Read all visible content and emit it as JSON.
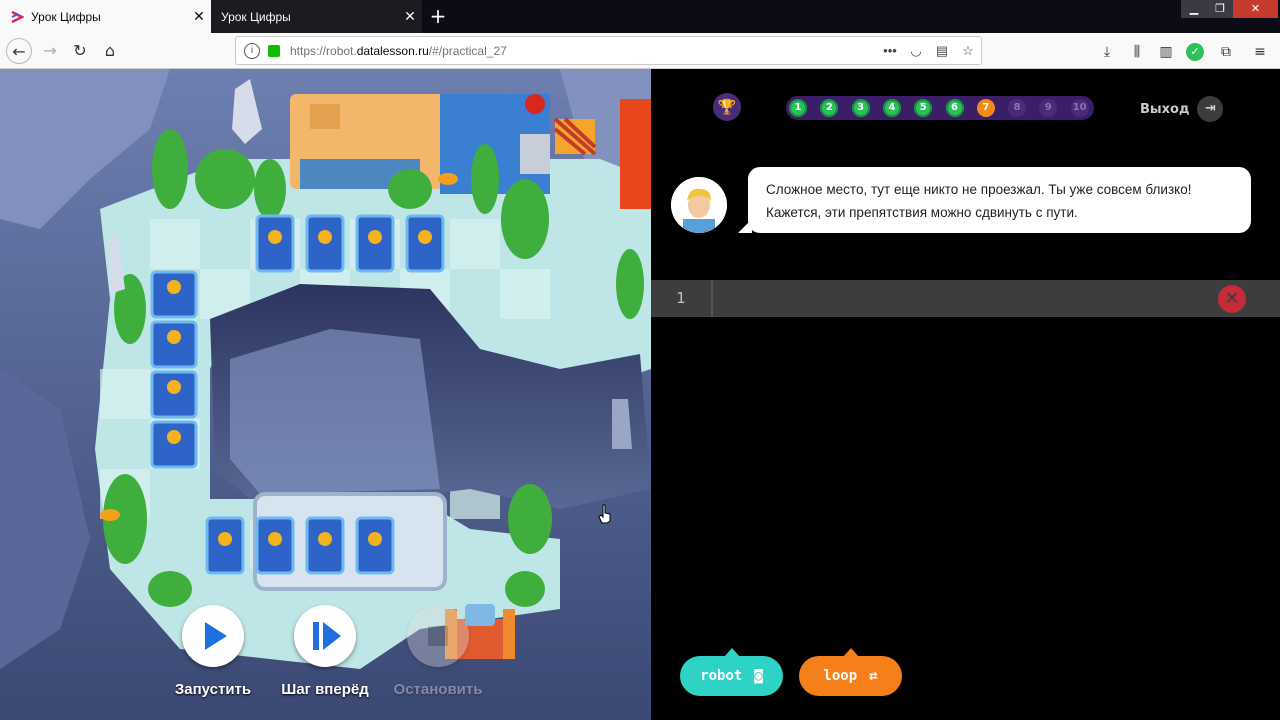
{
  "browser": {
    "tabs": [
      {
        "title": "Урок Цифры",
        "active": true
      },
      {
        "title": "Урок Цифры",
        "active": false
      }
    ],
    "url_prefix": "https://robot.",
    "url_domain": "datalesson.ru",
    "url_suffix": "/#/practical_27"
  },
  "game": {
    "steps": [
      "1",
      "2",
      "3",
      "4",
      "5",
      "6",
      "7",
      "8",
      "9",
      "10"
    ],
    "current_step": 7,
    "exit_label": "Выход",
    "controls": {
      "run": "Запустить",
      "step": "Шаг вперёд",
      "stop": "Остановить"
    }
  },
  "dialog": {
    "line1": "Сложное место, тут еще никто не проезжал. Ты уже совсем близко!",
    "line2": "Кажется, эти препятствия можно сдвинуть с пути."
  },
  "editor": {
    "line_number": "1"
  },
  "commands": [
    {
      "label": "robot",
      "icon": "robot-icon",
      "color": "#2ed3c6"
    },
    {
      "label": "loop",
      "icon": "loop-icon",
      "color": "#f5801a"
    }
  ]
}
